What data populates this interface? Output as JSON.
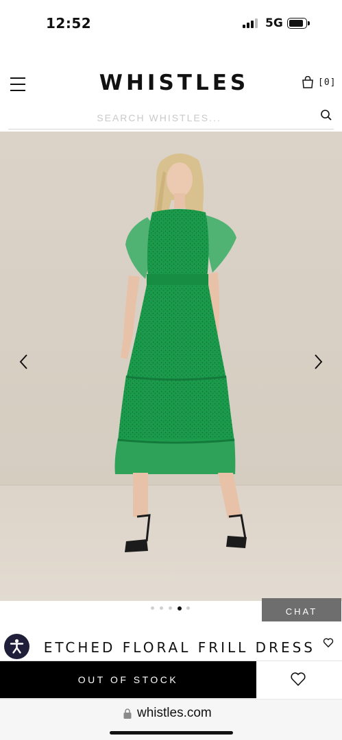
{
  "status_bar": {
    "time": "12:52",
    "network": "5G",
    "battery_level": 0.85
  },
  "header": {
    "brand": "WHISTLES",
    "bag_count": "[0]"
  },
  "search": {
    "placeholder": "SEARCH WHISTLES..."
  },
  "carousel": {
    "slide_count": 5,
    "active_index": 3
  },
  "chat": {
    "label": "CHAT"
  },
  "product": {
    "title": "ETCHED FLORAL FRILL DRESS"
  },
  "actions": {
    "out_of_stock_label": "OUT OF STOCK"
  },
  "browser": {
    "url": "whistles.com"
  },
  "colors": {
    "dress": "#1a9a4a",
    "backdrop": "#d8d0c5",
    "button": "#000000",
    "chat": "#6e6e6e"
  },
  "icons": [
    "menu-icon",
    "bag-icon",
    "search-icon",
    "chevron-left-icon",
    "chevron-right-icon",
    "accessibility-icon",
    "heart-icon",
    "lock-icon"
  ]
}
